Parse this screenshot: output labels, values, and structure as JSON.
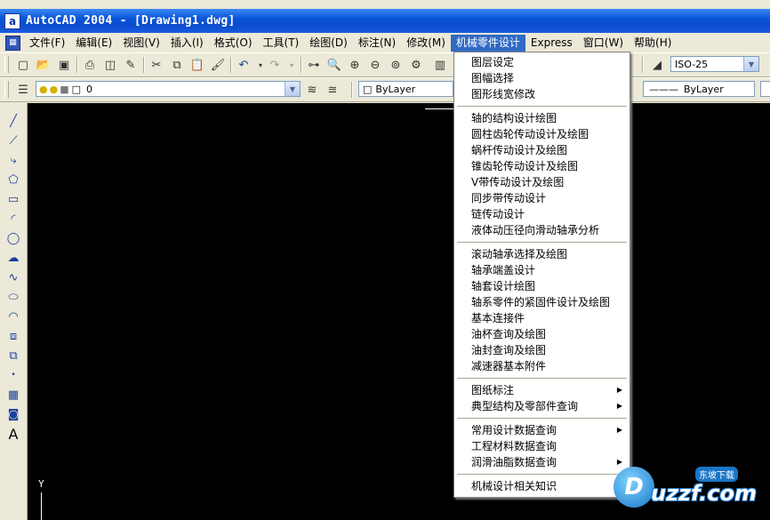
{
  "window": {
    "title": "AutoCAD 2004 - [Drawing1.dwg]",
    "app_icon": "a"
  },
  "menubar": {
    "items": [
      "文件(F)",
      "编辑(E)",
      "视图(V)",
      "插入(I)",
      "格式(O)",
      "工具(T)",
      "绘图(D)",
      "标注(N)",
      "修改(M)",
      "机械零件设计",
      "Express",
      "窗口(W)",
      "帮助(H)"
    ]
  },
  "toolbar": {
    "dimstyle_value": "ISO-25",
    "layer_value": "0",
    "color_value": "ByLayer",
    "linetype_value": "ByLayer",
    "icons": [
      "new-icon",
      "open-icon",
      "save-icon",
      "print-icon",
      "preview-icon",
      "publish-icon",
      "cut-icon",
      "copy-icon",
      "paste-icon",
      "matchprop-icon",
      "undo-icon",
      "redo-icon",
      "pan-icon",
      "zoom-realtime-icon",
      "zoom-window-icon",
      "zoom-previous-icon",
      "properties-icon",
      "designcenter-icon"
    ]
  },
  "left_toolbar": {
    "icons": [
      "line-icon",
      "construction-line-icon",
      "polyline-icon",
      "polygon-icon",
      "rectangle-icon",
      "arc-icon",
      "circle-icon",
      "revcloud-icon",
      "spline-icon",
      "ellipse-icon",
      "ellipse-arc-icon",
      "insert-block-icon",
      "make-block-icon",
      "point-icon",
      "hatch-icon",
      "region-icon",
      "text-icon"
    ]
  },
  "dropdown": {
    "groups": [
      [
        "图层设定",
        "图幅选择",
        "图形线宽修改"
      ],
      [
        "轴的结构设计绘图",
        "圆柱齿轮传动设计及绘图",
        "蜗杆传动设计及绘图",
        "锥齿轮传动设计及绘图",
        "V带传动设计及绘图",
        "同步带传动设计",
        "链传动设计",
        "液体动压径向滑动轴承分析"
      ],
      [
        "滚动轴承选择及绘图",
        "轴承端盖设计",
        "轴套设计绘图",
        "轴系零件的紧固件设计及绘图",
        "基本连接件",
        "油杯查询及绘图",
        "油封查询及绘图",
        "减速器基本附件"
      ],
      [
        "图纸标注",
        "典型结构及零部件查询"
      ],
      [
        "常用设计数据查询",
        "工程材料数据查询",
        "润滑油脂数据查询"
      ],
      [
        "机械设计相关知识"
      ]
    ],
    "submenu_items": [
      "图纸标注",
      "典型结构及零部件查询",
      "常用设计数据查询",
      "润滑油脂数据查询"
    ]
  },
  "canvas": {
    "ucs_label": "Y"
  },
  "watermark": {
    "logo": "D",
    "text": "uzzf.com",
    "badge": "东坡下载"
  },
  "colors": {
    "title_bar": "#0a55d8",
    "menu_highlight": "#316ac5",
    "canvas": "#000000",
    "chrome": "#ece9d8"
  }
}
